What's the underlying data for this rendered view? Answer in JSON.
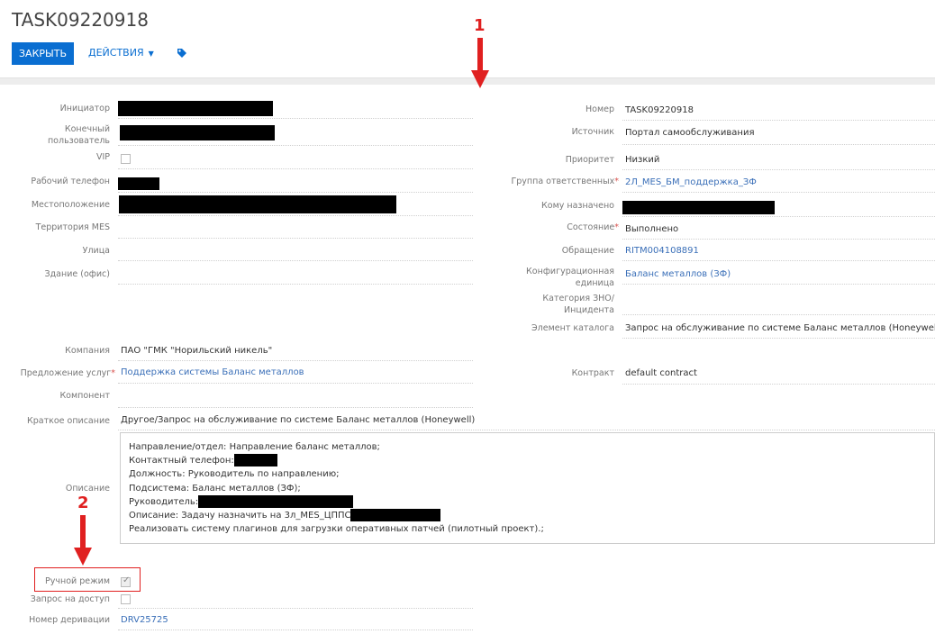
{
  "header": {
    "title": "TASK09220918",
    "close_label": "ЗАКРЫТЬ",
    "actions_label": "ДЕЙСТВИЯ"
  },
  "left": {
    "initiator_label": "Инициатор",
    "end_user_label": "Конечный пользователь",
    "vip_label": "VIP",
    "work_phone_label": "Рабочий телефон",
    "location_label": "Местоположение",
    "territory_label": "Территория MES",
    "street_label": "Улица",
    "building_label": "Здание (офис)",
    "company_label": "Компания",
    "company_value": "ПАО \"ГМК \"Норильский никель\"",
    "service_offer_label": "Предложение услуг",
    "service_offer_value": "Поддержка системы Баланс металлов",
    "component_label": "Компонент",
    "short_desc_label": "Краткое описание",
    "short_desc_value": "Другое/Запрос на обслуживание по системе Баланс металлов (Honeywell)",
    "description_label": "Описание",
    "manual_mode_label": "Ручной режим",
    "access_request_label": "Запрос на доступ",
    "derivation_label": "Номер деривации",
    "derivation_value": "DRV25725"
  },
  "right": {
    "number_label": "Номер",
    "number_value": "TASK09220918",
    "source_label": "Источник",
    "source_value": "Портал самообслуживания",
    "priority_label": "Приоритет",
    "priority_value": "Низкий",
    "group_label": "Группа ответственных",
    "group_value": "2Л_MES_БМ_поддержка_ЗФ",
    "assigned_label": "Кому назначено",
    "state_label": "Состояние",
    "state_value": "Выполнено",
    "request_label": "Обращение",
    "request_value": "RITM004108891",
    "ci_label": "Конфигурационная единица",
    "ci_value": "Баланс металлов (ЗФ)",
    "category_label": "Категория ЗНО/ Инцидента",
    "catalog_label": "Элемент каталога",
    "catalog_value": "Запрос на обслуживание по системе Баланс металлов (Honeywell)",
    "contract_label": "Контракт",
    "contract_value": "default contract"
  },
  "description": {
    "line1": "Направление/отдел: Направление баланс металлов;",
    "line2": "Контактный телефон:",
    "line3": "Должность: Руководитель по направлению;",
    "line4": "Подсистема: Баланс металлов (ЗФ);",
    "line5": "Руководитель:",
    "line6": "Описание: Задачу назначить на 3л_MES_ЦППС.",
    "line7": "Реализовать систему плагинов для загрузки оперативных патчей (пилотный проект).;"
  },
  "annotations": {
    "marker1": "1",
    "marker2": "2",
    "color": "#e02020"
  },
  "colors": {
    "primary": "#0a6ed1",
    "link": "#3a6fb8"
  }
}
